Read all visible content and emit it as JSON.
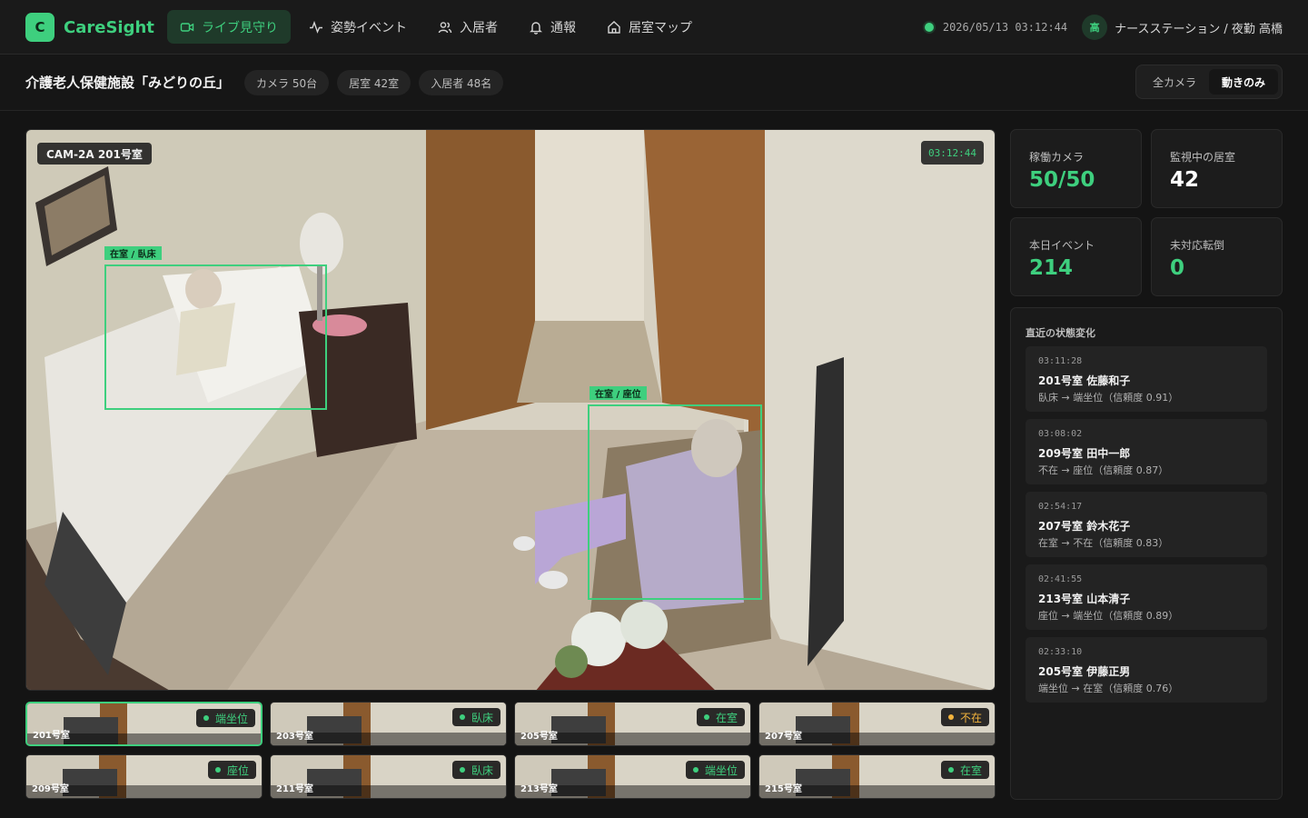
{
  "app": {
    "logo_letter": "C",
    "name": "CareSight"
  },
  "nav": [
    {
      "label": "ライブ見守り",
      "icon": "video-camera-icon",
      "active": true
    },
    {
      "label": "姿勢イベント",
      "icon": "activity-pulse-icon",
      "active": false
    },
    {
      "label": "入居者",
      "icon": "users-icon",
      "active": false
    },
    {
      "label": "通報",
      "icon": "bell-icon",
      "active": false
    },
    {
      "label": "居室マップ",
      "icon": "home-icon",
      "active": false
    }
  ],
  "header": {
    "datetime": "2026/05/13 03:12:44",
    "user_initial": "高",
    "user_label": "ナースステーション / 夜勤 高橋"
  },
  "facility": {
    "name": "介護老人保健施設「みどりの丘」",
    "chips": [
      "カメラ 50台",
      "居室 42室",
      "入居者 48名"
    ],
    "filters": [
      {
        "label": "全カメラ",
        "active": false
      },
      {
        "label": "動きのみ",
        "active": true
      }
    ]
  },
  "video": {
    "camera_label": "CAM-2A 201号室",
    "timestamp": "03:12:44",
    "detections": [
      {
        "label": "在室 / 臥床"
      },
      {
        "label": "在室 / 座位"
      }
    ]
  },
  "thumbnails": [
    {
      "room": "201号室",
      "status": "端坐位",
      "status_type": "ok",
      "selected": true
    },
    {
      "room": "203号室",
      "status": "臥床",
      "status_type": "ok",
      "selected": false
    },
    {
      "room": "205号室",
      "status": "在室",
      "status_type": "ok",
      "selected": false
    },
    {
      "room": "207号室",
      "status": "不在",
      "status_type": "warn",
      "selected": false
    },
    {
      "room": "209号室",
      "status": "座位",
      "status_type": "ok",
      "selected": false
    },
    {
      "room": "211号室",
      "status": "臥床",
      "status_type": "ok",
      "selected": false
    },
    {
      "room": "213号室",
      "status": "端坐位",
      "status_type": "ok",
      "selected": false
    },
    {
      "room": "215号室",
      "status": "在室",
      "status_type": "ok",
      "selected": false
    }
  ],
  "stats": [
    {
      "label": "稼働カメラ",
      "value": "50/50",
      "highlight": true
    },
    {
      "label": "監視中の居室",
      "value": "42",
      "highlight": false
    },
    {
      "label": "本日イベント",
      "value": "214",
      "highlight": true
    },
    {
      "label": "未対応転倒",
      "value": "0",
      "highlight": true
    }
  ],
  "feed": {
    "title": "直近の状態変化",
    "items": [
      {
        "time": "03:11:28",
        "title": "201号室 佐藤和子",
        "desc": "臥床 → 端坐位（信頼度 0.91）"
      },
      {
        "time": "03:08:02",
        "title": "209号室 田中一郎",
        "desc": "不在 → 座位（信頼度 0.87）"
      },
      {
        "time": "02:54:17",
        "title": "207号室 鈴木花子",
        "desc": "在室 → 不在（信頼度 0.83）"
      },
      {
        "time": "02:41:55",
        "title": "213号室 山本清子",
        "desc": "座位 → 端坐位（信頼度 0.89）"
      },
      {
        "time": "02:33:10",
        "title": "205号室 伊藤正男",
        "desc": "端坐位 → 在室（信頼度 0.76）"
      }
    ]
  },
  "colors": {
    "accent": "#3ecf7e",
    "warn": "#f2b33d",
    "background": "#141414",
    "panel": "#1c1c1c"
  }
}
